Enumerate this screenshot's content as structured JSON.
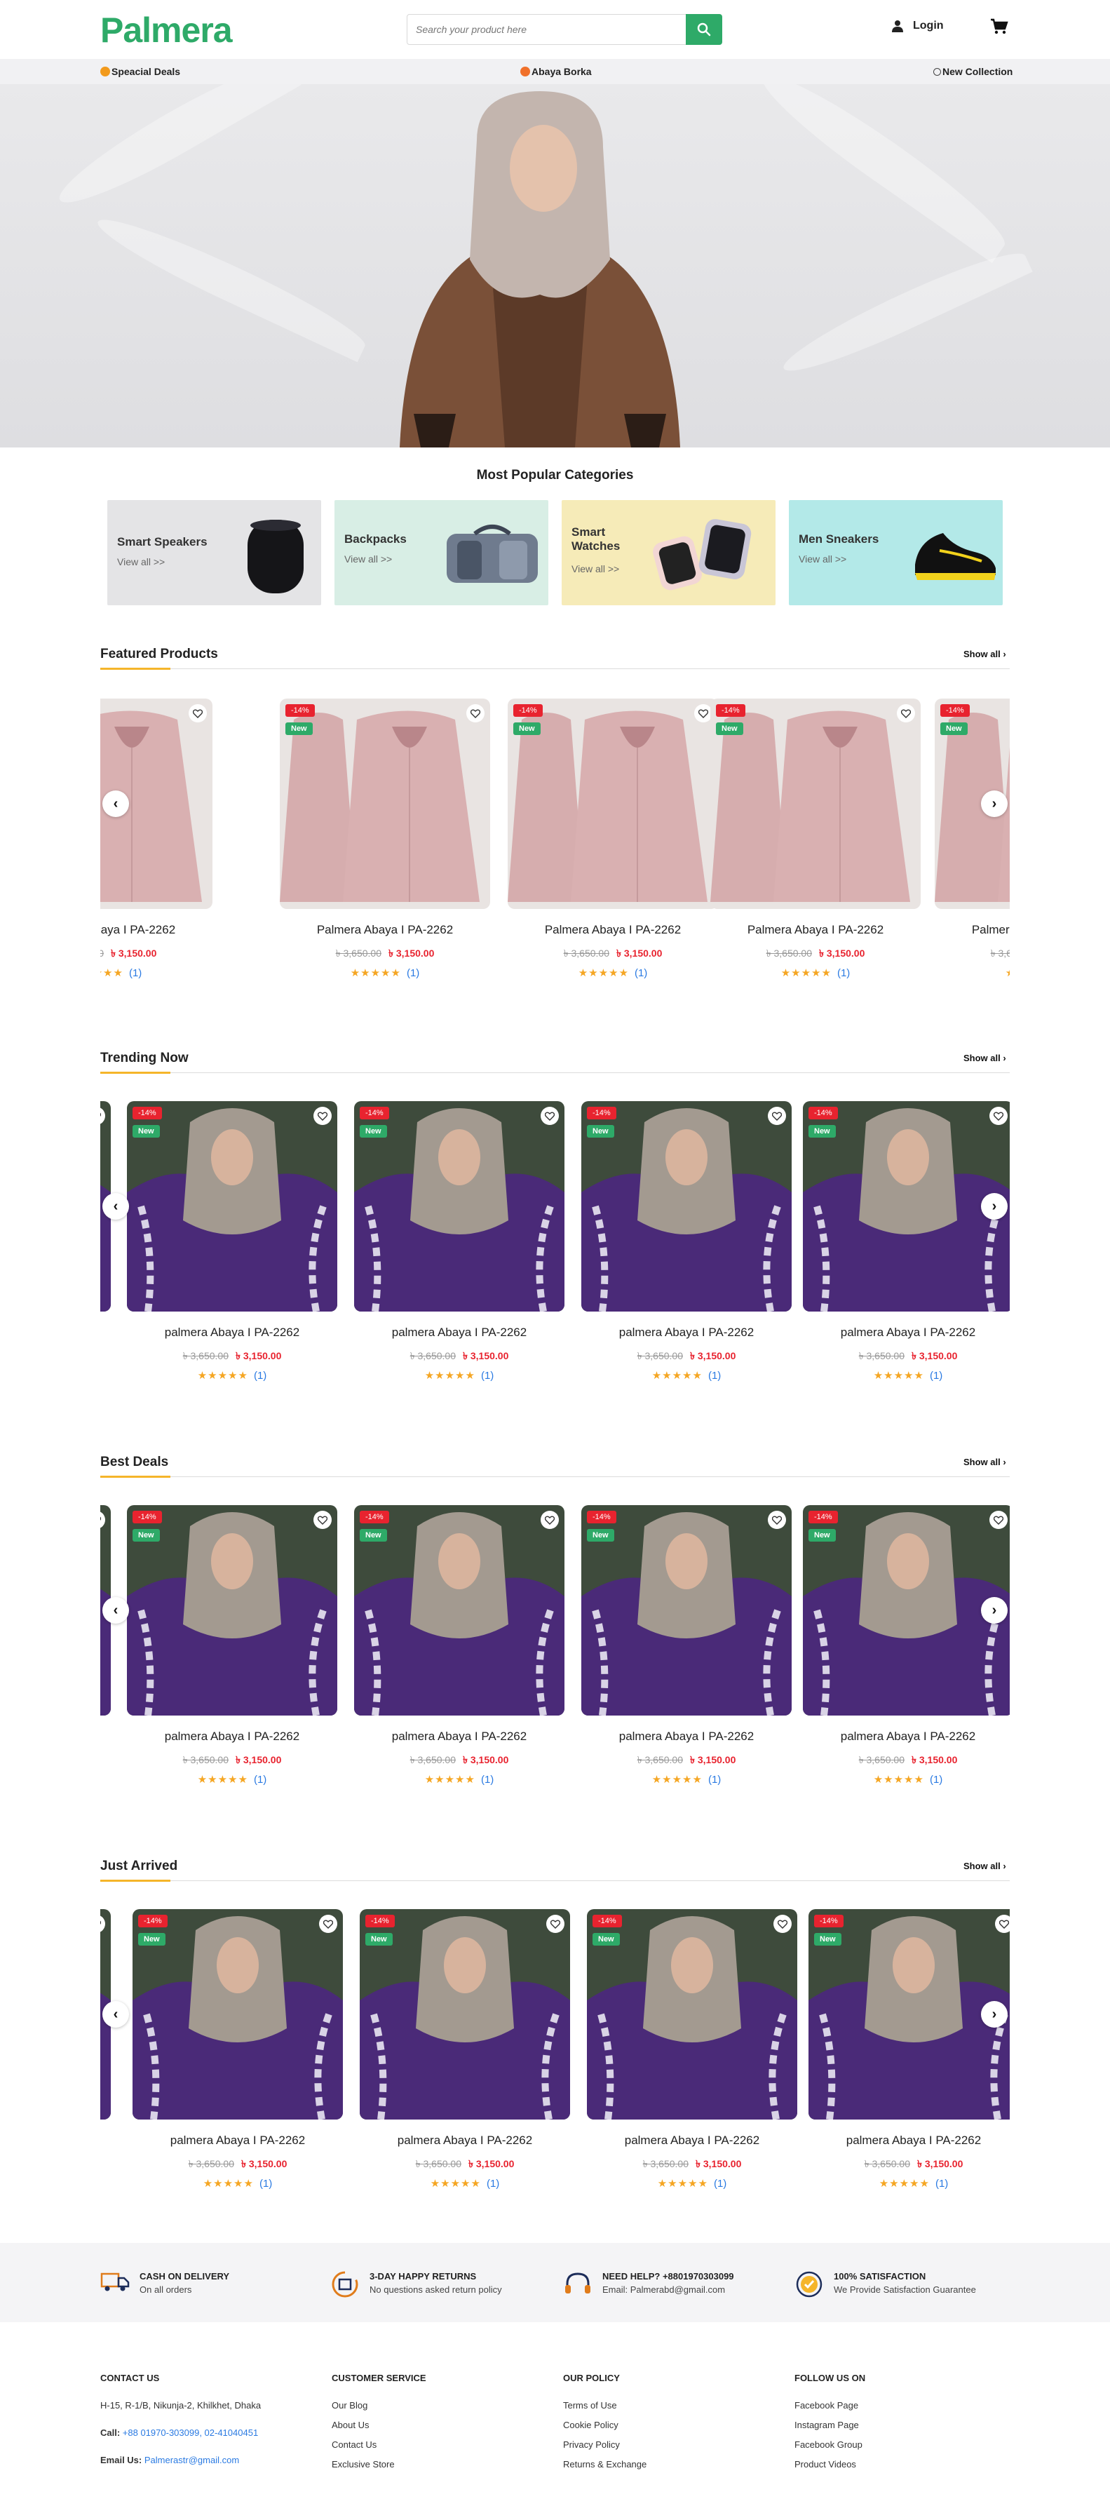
{
  "header": {
    "logo": "Palmera",
    "search_placeholder": "Search your product here",
    "login": "Login"
  },
  "subnav": {
    "special_deals": "Speacial Deals",
    "abaya_borka": "Abaya Borka",
    "new_collection": "New Collection"
  },
  "categories": {
    "title": "Most Popular Categories",
    "items": [
      {
        "name": "Smart Speakers",
        "view": "View all >>",
        "bg": "#e4e4e6"
      },
      {
        "name": "Backpacks",
        "view": "View all >>",
        "bg": "#d8eee5"
      },
      {
        "name": "Smart Watches",
        "view": "View all >>",
        "bg": "#f6ebb8"
      },
      {
        "name": "Men Sneakers",
        "view": "View all >>",
        "bg": "#b3e9e8"
      }
    ]
  },
  "sections": {
    "featured": {
      "title": "Featured Products",
      "show_all": "Show all"
    },
    "trending": {
      "title": "Trending Now",
      "show_all": "Show all"
    },
    "best": {
      "title": "Best Deals",
      "show_all": "Show all"
    },
    "arrived": {
      "title": "Just Arrived",
      "show_all": "Show all"
    }
  },
  "product": {
    "name": "palmera Abaya I PA-2262",
    "name_cap": "Palmera Abaya I PA-2262",
    "old_price": "৳ 3,650.00",
    "new_price": "৳ 3,150.00",
    "discount": "-14%",
    "new_badge": "New",
    "rating_count": "(1)",
    "stars": "★★★★★"
  },
  "features": [
    {
      "title": "CASH ON DELIVERY",
      "sub": "On all orders",
      "icon": "truck-icon"
    },
    {
      "title": "3-DAY HAPPY RETURNS",
      "sub": "No questions asked return policy",
      "icon": "return-icon"
    },
    {
      "title": "NEED HELP? +8801970303099",
      "sub": "Email: Palmerabd@gmail.com",
      "icon": "headset-icon"
    },
    {
      "title": "100% SATISFACTION",
      "sub": "We Provide Satisfaction Guarantee",
      "icon": "badge-icon"
    }
  ],
  "footer": {
    "contact": {
      "title": "CONTACT US",
      "address": "H-15, R-1/B, Nikunja-2, Khilkhet, Dhaka",
      "call_label": "Call:",
      "call": "+88 01970-303099, 02-41040451",
      "email_label": "Email Us:",
      "email": "Palmerastr@gmail.com"
    },
    "service": {
      "title": "CUSTOMER SERVICE",
      "links": [
        "Our Blog",
        "About Us",
        "Contact Us",
        "Exclusive Store"
      ]
    },
    "policy": {
      "title": "OUR POLICY",
      "links": [
        "Terms of Use",
        "Cookie Policy",
        "Privacy Policy",
        "Returns & Exchange"
      ]
    },
    "follow": {
      "title": "FOLLOW US ON",
      "links": [
        "Facebook Page",
        "Instagram Page",
        "Facebook Group",
        "Product Videos"
      ]
    }
  },
  "colors": {
    "brand": "#2eaa68",
    "sale": "#e8232f",
    "star": "#f5a623",
    "accent": "#f5b52a"
  }
}
